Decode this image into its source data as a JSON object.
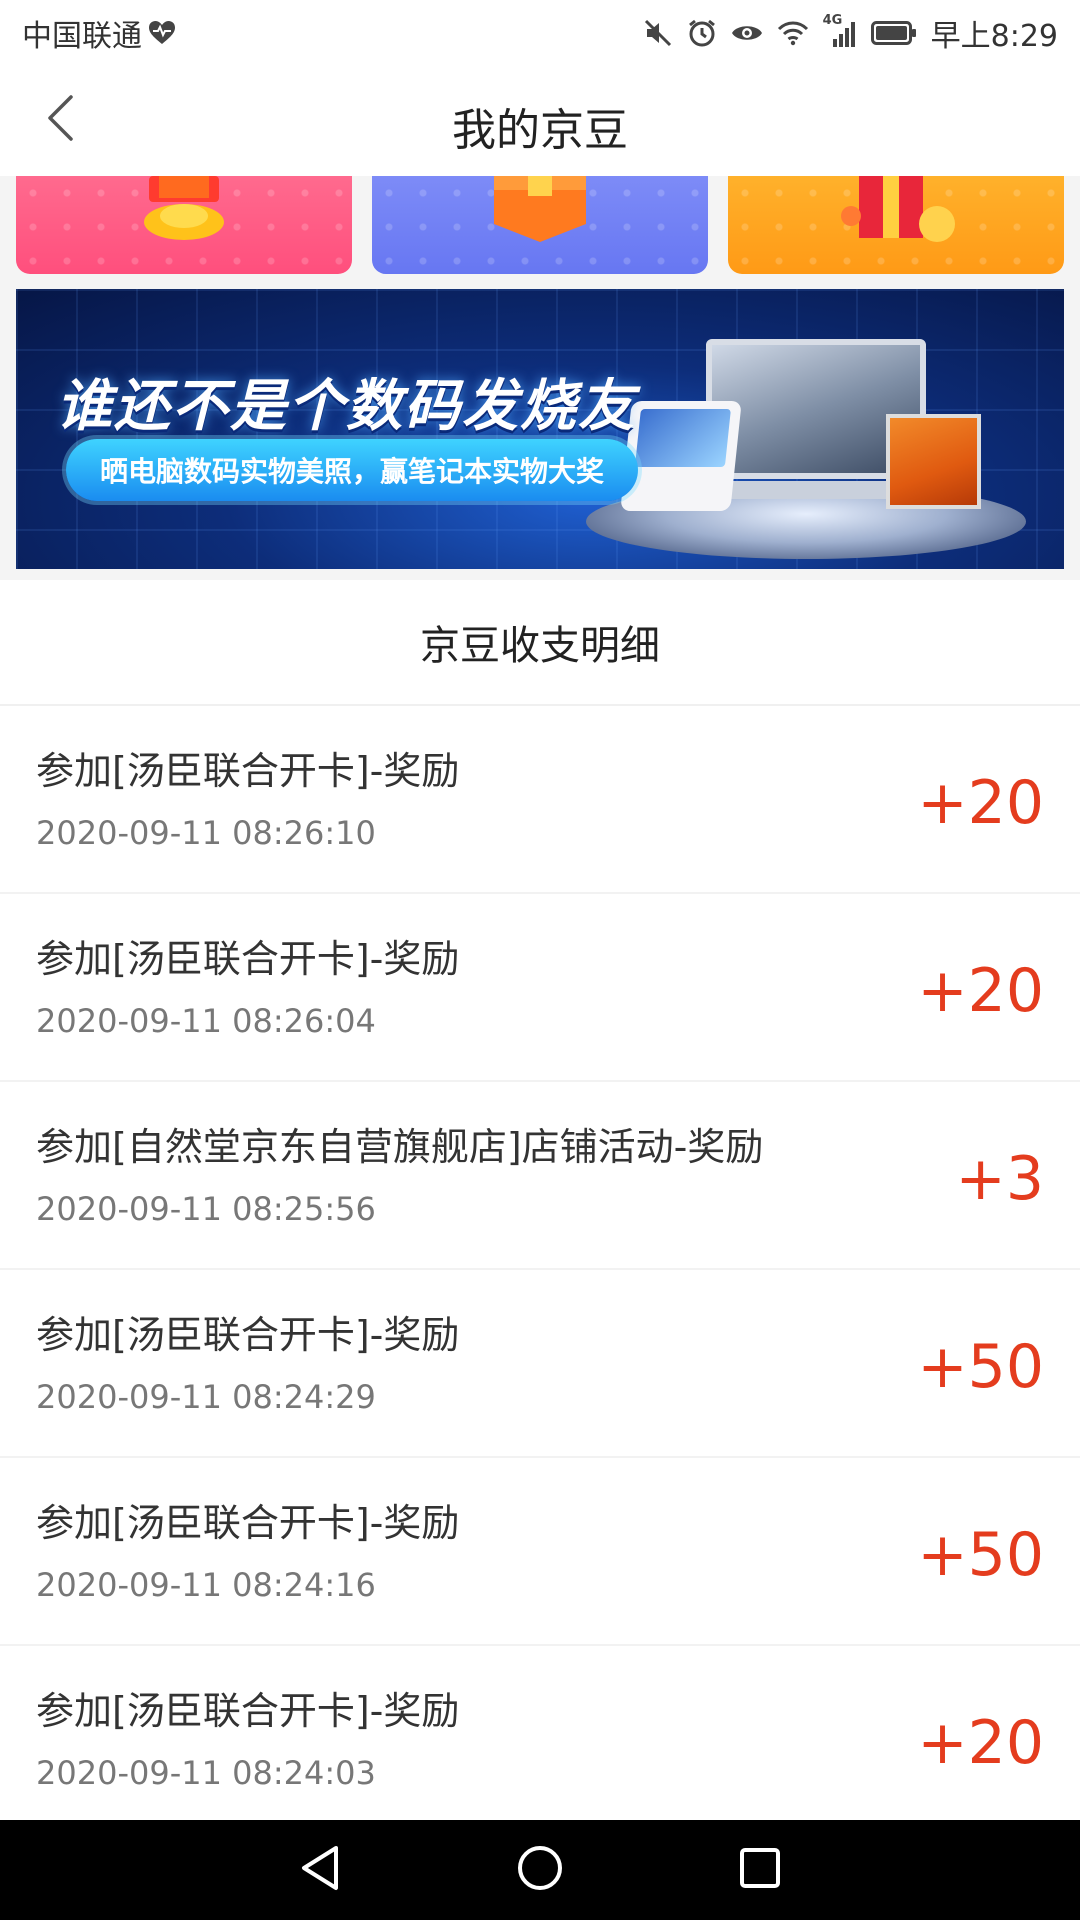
{
  "status_bar": {
    "carrier": "中国联通",
    "time": "早上8:29",
    "network": "4G",
    "icons": [
      "heart-health-icon",
      "mute-icon",
      "alarm-icon",
      "eye-icon",
      "wifi-icon",
      "signal-icon",
      "battery-icon"
    ]
  },
  "header": {
    "title": "我的京豆",
    "back_icon": "chevron-left-icon"
  },
  "banner": {
    "headline": "谁还不是个数码发烧友",
    "subline": "晒电脑数码实物美照，赢笔记本实物大奖"
  },
  "list": {
    "heading": "京豆收支明细",
    "items": [
      {
        "title": "参加[汤臣联合开卡]-奖励",
        "time": "2020-09-11 08:26:10",
        "amount": "+20"
      },
      {
        "title": "参加[汤臣联合开卡]-奖励",
        "time": "2020-09-11 08:26:04",
        "amount": "+20"
      },
      {
        "title": "参加[自然堂京东自营旗舰店]店铺活动-奖励",
        "time": "2020-09-11 08:25:56",
        "amount": "+3"
      },
      {
        "title": "参加[汤臣联合开卡]-奖励",
        "time": "2020-09-11 08:24:29",
        "amount": "+50"
      },
      {
        "title": "参加[汤臣联合开卡]-奖励",
        "time": "2020-09-11 08:24:16",
        "amount": "+50"
      },
      {
        "title": "参加[汤臣联合开卡]-奖励",
        "time": "2020-09-11 08:24:03",
        "amount": "+20"
      }
    ]
  },
  "colors": {
    "amount": "#e43c1e",
    "promo_pink": "#ff4f7d",
    "promo_blue": "#6777f2",
    "promo_orange": "#ff9a16"
  },
  "nav_bar": {
    "icons": [
      "back-triangle-icon",
      "home-circle-icon",
      "recents-square-icon"
    ]
  }
}
